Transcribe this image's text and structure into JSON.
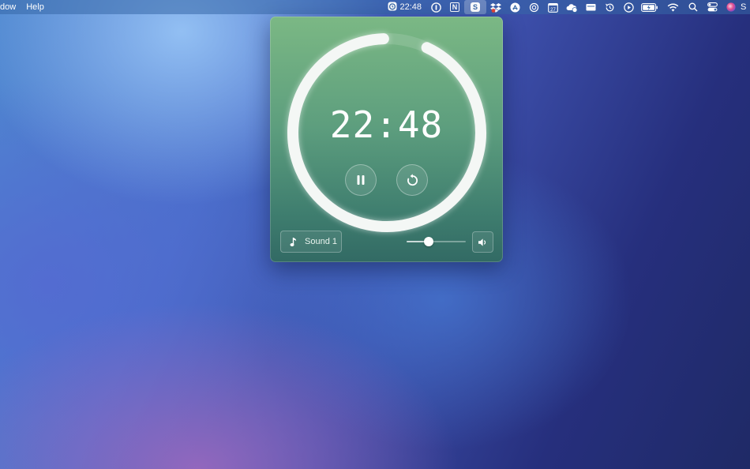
{
  "menubar": {
    "left_items": [
      "dow",
      "Help"
    ],
    "clock_time": "22:48",
    "trailing_text": "S",
    "icons": [
      {
        "name": "clock-timer-icon"
      },
      {
        "name": "onepassword-icon"
      },
      {
        "name": "notion-icon",
        "glyph": "N"
      },
      {
        "name": "skype-icon",
        "glyph": "S"
      },
      {
        "name": "dropbox-icon"
      },
      {
        "name": "app-store-icon"
      },
      {
        "name": "chatgpt-icon"
      },
      {
        "name": "calendar-icon",
        "glyph": "27"
      },
      {
        "name": "weather-icon"
      },
      {
        "name": "display-icon"
      },
      {
        "name": "time-machine-icon"
      },
      {
        "name": "play-icon"
      },
      {
        "name": "battery-icon"
      },
      {
        "name": "wifi-icon"
      },
      {
        "name": "spotlight-search-icon"
      },
      {
        "name": "control-center-icon"
      },
      {
        "name": "siri-icon"
      }
    ]
  },
  "timer": {
    "time": "22:48",
    "progress": 0.95,
    "state": "running"
  },
  "controls": {
    "sound_label": "Sound 1",
    "volume_level": 0.37
  },
  "colors": {
    "panel_top": "#7bb884",
    "panel_bottom": "#326a64",
    "ring": "#f4f7f5"
  }
}
